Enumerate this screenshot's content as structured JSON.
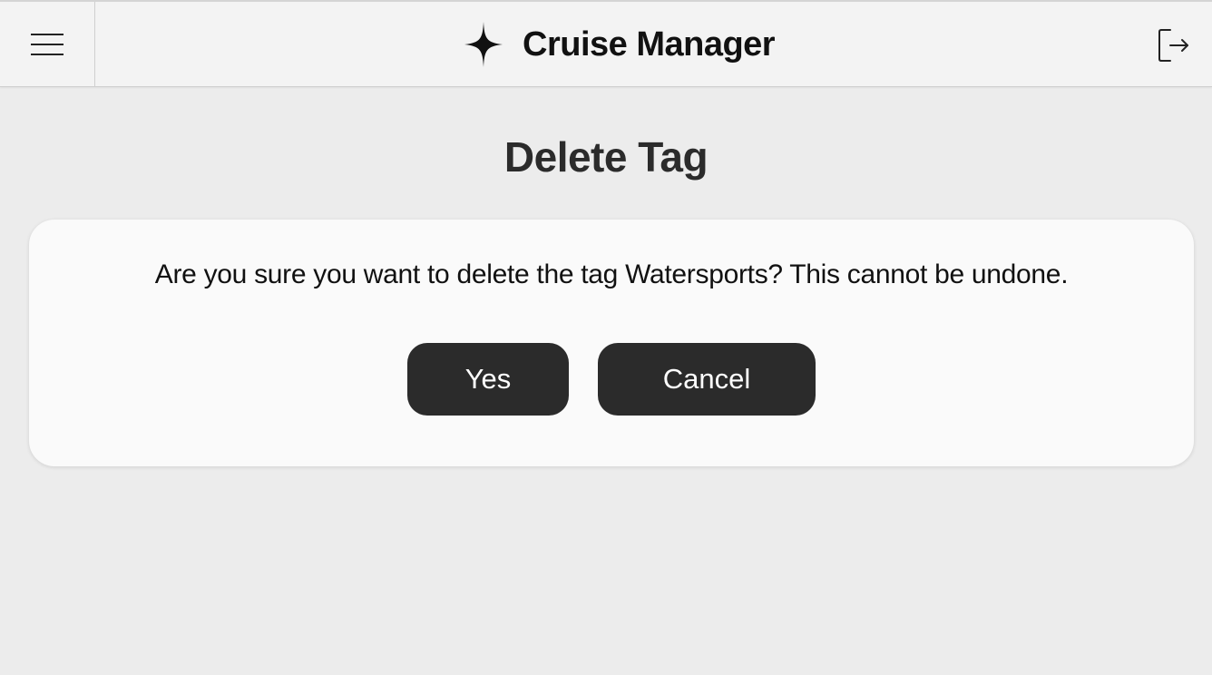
{
  "header": {
    "app_title": "Cruise Manager",
    "menu_icon": "hamburger-menu-icon",
    "logo_icon": "four-point-star-icon",
    "logout_icon": "logout-icon"
  },
  "page": {
    "title": "Delete Tag"
  },
  "dialog": {
    "message": "Are you sure you want to delete the tag Watersports? This cannot be undone.",
    "confirm_label": "Yes",
    "cancel_label": "Cancel"
  },
  "colors": {
    "background": "#ececec",
    "header_bg": "#f3f3f3",
    "card_bg": "#fafafa",
    "button_bg": "#2b2b2b",
    "button_text": "#ffffff"
  }
}
